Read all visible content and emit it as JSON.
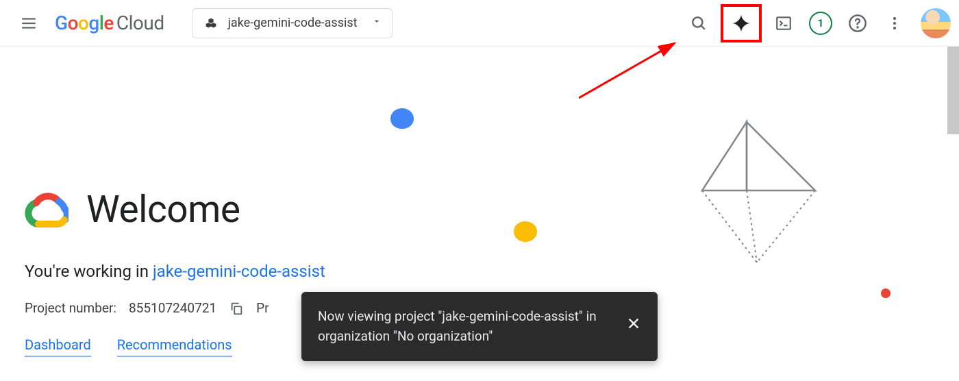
{
  "header": {
    "logo_text_cloud": "Cloud",
    "project_name": "jake-gemini-code-assist",
    "notification_count": "1"
  },
  "main": {
    "welcome_title": "Welcome",
    "working_in_prefix": "You're working in ",
    "working_in_project": "jake-gemini-code-assist",
    "project_number_label": "Project number:",
    "project_number_value": "855107240721",
    "project_id_label_truncated": "Pr",
    "link_dashboard": "Dashboard",
    "link_recommendations": "Recommendations"
  },
  "toast": {
    "message": "Now viewing project \"jake-gemini-code-assist\" in organization \"No organization\""
  }
}
